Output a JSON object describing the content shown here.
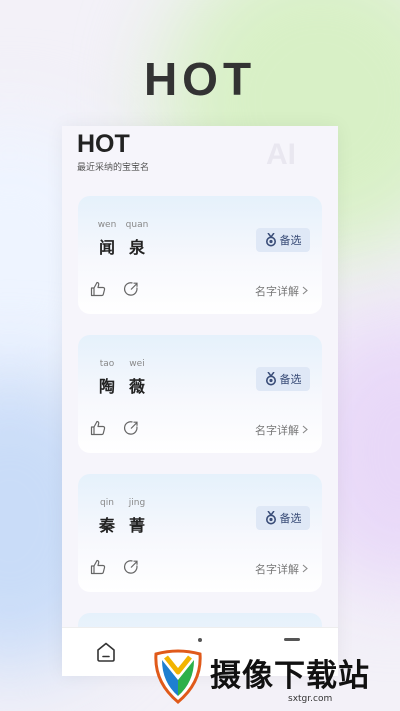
{
  "hero": {
    "title": "HOT"
  },
  "screen": {
    "title": "HOT",
    "subtitle": "最近采纳的宝宝名",
    "watermark": "AI",
    "cards": [
      {
        "chars": [
          {
            "pinyin": "wen",
            "hanzi": "闻"
          },
          {
            "pinyin": "quan",
            "hanzi": "泉"
          }
        ],
        "backup_label": "备选",
        "detail_label": "名字详解"
      },
      {
        "chars": [
          {
            "pinyin": "tao",
            "hanzi": "陶"
          },
          {
            "pinyin": "wei",
            "hanzi": "薇"
          }
        ],
        "backup_label": "备选",
        "detail_label": "名字详解"
      },
      {
        "chars": [
          {
            "pinyin": "qin",
            "hanzi": "秦"
          },
          {
            "pinyin": "jing",
            "hanzi": "菁"
          }
        ],
        "backup_label": "备选",
        "detail_label": "名字详解"
      }
    ]
  },
  "watermark_site": {
    "name": "摄像下载站",
    "url": "sxtgr.com"
  },
  "colors": {
    "accent": "#3a4d78",
    "backup_bg": "#dfe8f6",
    "text": "#222222"
  }
}
